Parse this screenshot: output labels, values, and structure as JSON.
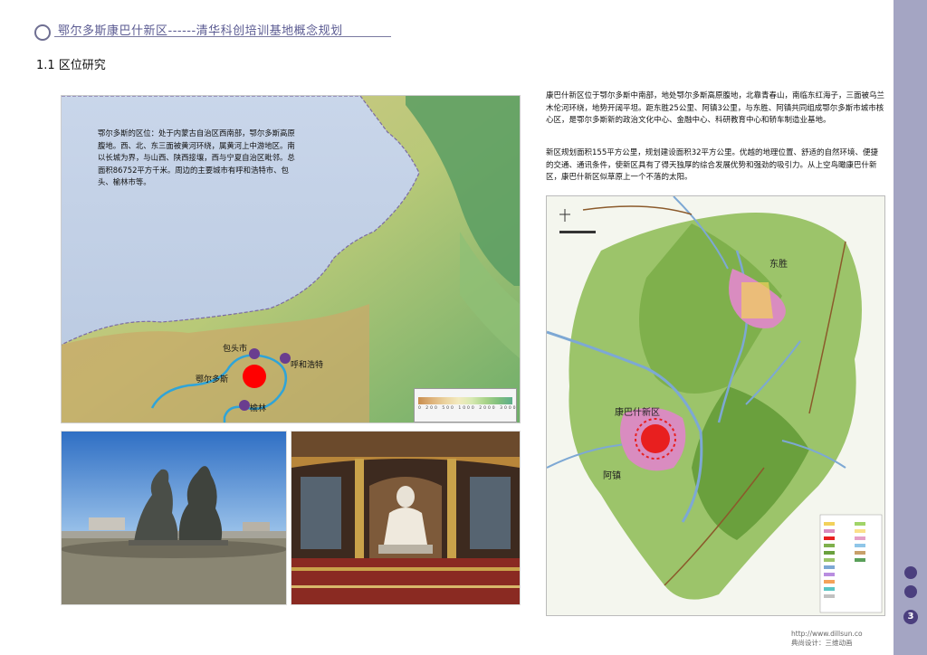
{
  "header": {
    "title": "鄂尔多斯康巴什新区------清华科创培训基地概念规划"
  },
  "section": {
    "heading": "1.1  区位研究"
  },
  "map": {
    "description": "鄂尔多斯的区位：处于内蒙古自治区西南部，鄂尔多斯高原腹地。西、北、东三面被黄河环绕，属黄河上中游地区。南以长城为界，与山西、陕西接壤，西与宁夏自治区毗邻。总面积86752平方千米。周边的主要城市有呼和浩特市、包头、榆林市等。",
    "cities": {
      "baotou": "包头市",
      "hohhot": "呼和浩特",
      "ordos": "鄂尔多斯",
      "yulin": "榆林"
    },
    "legend_ticks": "0 200 500 1000 2000 3000"
  },
  "right_text": {
    "paragraph1": "康巴什新区位于鄂尔多斯中南部，地处鄂尔多斯高原腹地，北靠青春山，南临东红海子，三面被乌兰木伦河环绕，地势开阔平坦。距东胜25公里、阿镇3公里，与东胜、阿镇共同组成鄂尔多斯市城市核心区，是鄂尔多斯新的政治文化中心、金融中心、科研教育中心和轿车制造业基地。",
    "paragraph2": "新区规划面积155平方公里，规划建设面积32平方公里。优越的地理位置、舒适的自然环境、便捷的交通、通讯条件，使新区具有了得天独厚的综合发展优势和强劲的吸引力。从上空鸟瞰康巴什新区，康巴什新区似草原上一个不落的太阳。"
  },
  "plan": {
    "labels": {
      "dongsheng": "东胜",
      "kangbashi": "康巴什新区",
      "azhen": "阿镇"
    }
  },
  "page": {
    "number": "3"
  },
  "watermark": {
    "line1": "http://www.dillsun.co",
    "line2": "典尚设计：三维动画"
  },
  "colors": {
    "accent": "#5b5b92",
    "sidebar": "#a4a5c3",
    "dot": "#4b3f7e",
    "plan_green": "#8dbb5a",
    "city_marker": "#ff0000"
  }
}
